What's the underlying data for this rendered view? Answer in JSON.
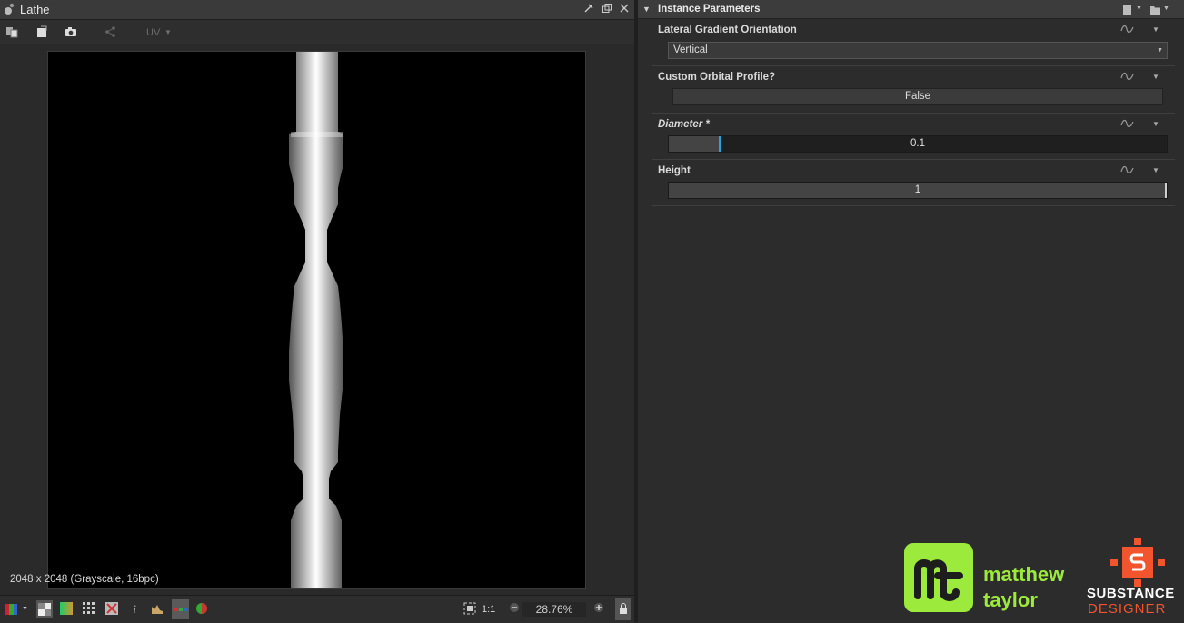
{
  "window": {
    "title": "Lathe"
  },
  "toolbar": {
    "uv_label": "UV"
  },
  "viewport": {
    "resolution_label": "2048 x 2048 (Grayscale, 16bpc)"
  },
  "bottom_bar": {
    "one_to_one": "1:1",
    "zoom": "28.76%"
  },
  "params": {
    "header": "Instance Parameters",
    "lateral": {
      "label": "Lateral Gradient Orientation",
      "value": "Vertical"
    },
    "custom": {
      "label": "Custom Orbital Profile?",
      "value": "False"
    },
    "diameter": {
      "label": "Diameter *",
      "value": "0.1",
      "fraction": 0.1
    },
    "height": {
      "label": "Height",
      "value": "1",
      "fraction": 1.0
    }
  },
  "branding": {
    "line1": "matthew",
    "line2": "taylor",
    "sd1": "SUBSTANCE",
    "sd2": "DESIGNER"
  },
  "colors": {
    "accent": "#2aa3e0",
    "logo_green": "#9cea3c",
    "sd_orange": "#f2542d"
  }
}
